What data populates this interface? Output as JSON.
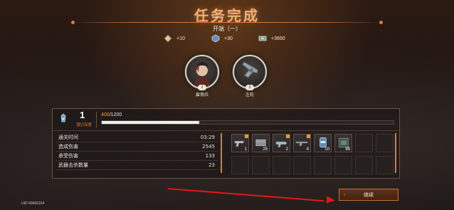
{
  "header": {
    "title": "任务完成",
    "subtitle": "开端（一）"
  },
  "rewards": [
    {
      "icon": "crystal-icon",
      "value": "+10"
    },
    {
      "icon": "chip-icon",
      "value": "+30"
    },
    {
      "icon": "money-icon",
      "value": "+3660"
    }
  ],
  "characters": [
    {
      "name": "雇佣兵",
      "level": "2",
      "icon": "mercenary-portrait"
    },
    {
      "name": "左轮",
      "level": "3",
      "icon": "revolver-portrait"
    }
  ],
  "depth": {
    "value": "1",
    "label": "潜识深度",
    "xp_current": "400",
    "xp_max": "/1200",
    "xp_progress": 0.3333
  },
  "stats": [
    {
      "label": "通关时间",
      "value": "03:29"
    },
    {
      "label": "造成伤害",
      "value": "2545"
    },
    {
      "label": "承受伤害",
      "value": "133"
    },
    {
      "label": "武器击杀数量",
      "value": "23"
    }
  ],
  "items": [
    {
      "icon": "pistol-icon",
      "count": "1",
      "tag": true
    },
    {
      "icon": "ammo-box-icon",
      "count": "25",
      "tag": false
    },
    {
      "icon": "blaster-icon",
      "count": "2",
      "tag": true
    },
    {
      "icon": "rifle-icon",
      "count": "4",
      "tag": true
    },
    {
      "icon": "canister-icon",
      "count": "10",
      "tag": false
    },
    {
      "icon": "case-icon",
      "count": "88",
      "tag": false
    },
    {
      "icon": "",
      "count": "",
      "tag": false
    },
    {
      "icon": "",
      "count": "",
      "tag": false
    },
    {
      "icon": "",
      "count": "",
      "tag": false
    },
    {
      "icon": "",
      "count": "",
      "tag": false
    },
    {
      "icon": "",
      "count": "",
      "tag": false
    },
    {
      "icon": "",
      "count": "",
      "tag": false
    },
    {
      "icon": "",
      "count": "",
      "tag": false
    },
    {
      "icon": "",
      "count": "",
      "tag": false
    },
    {
      "icon": "",
      "count": "",
      "tag": false
    },
    {
      "icon": "",
      "count": "",
      "tag": false
    }
  ],
  "footer": {
    "uid": "UID 60666104",
    "continue_label": "继续"
  },
  "colors": {
    "accent": "#e07a3a",
    "title": "#f1b07a",
    "xp": "#f0a23a",
    "arrow": "#e01818"
  }
}
